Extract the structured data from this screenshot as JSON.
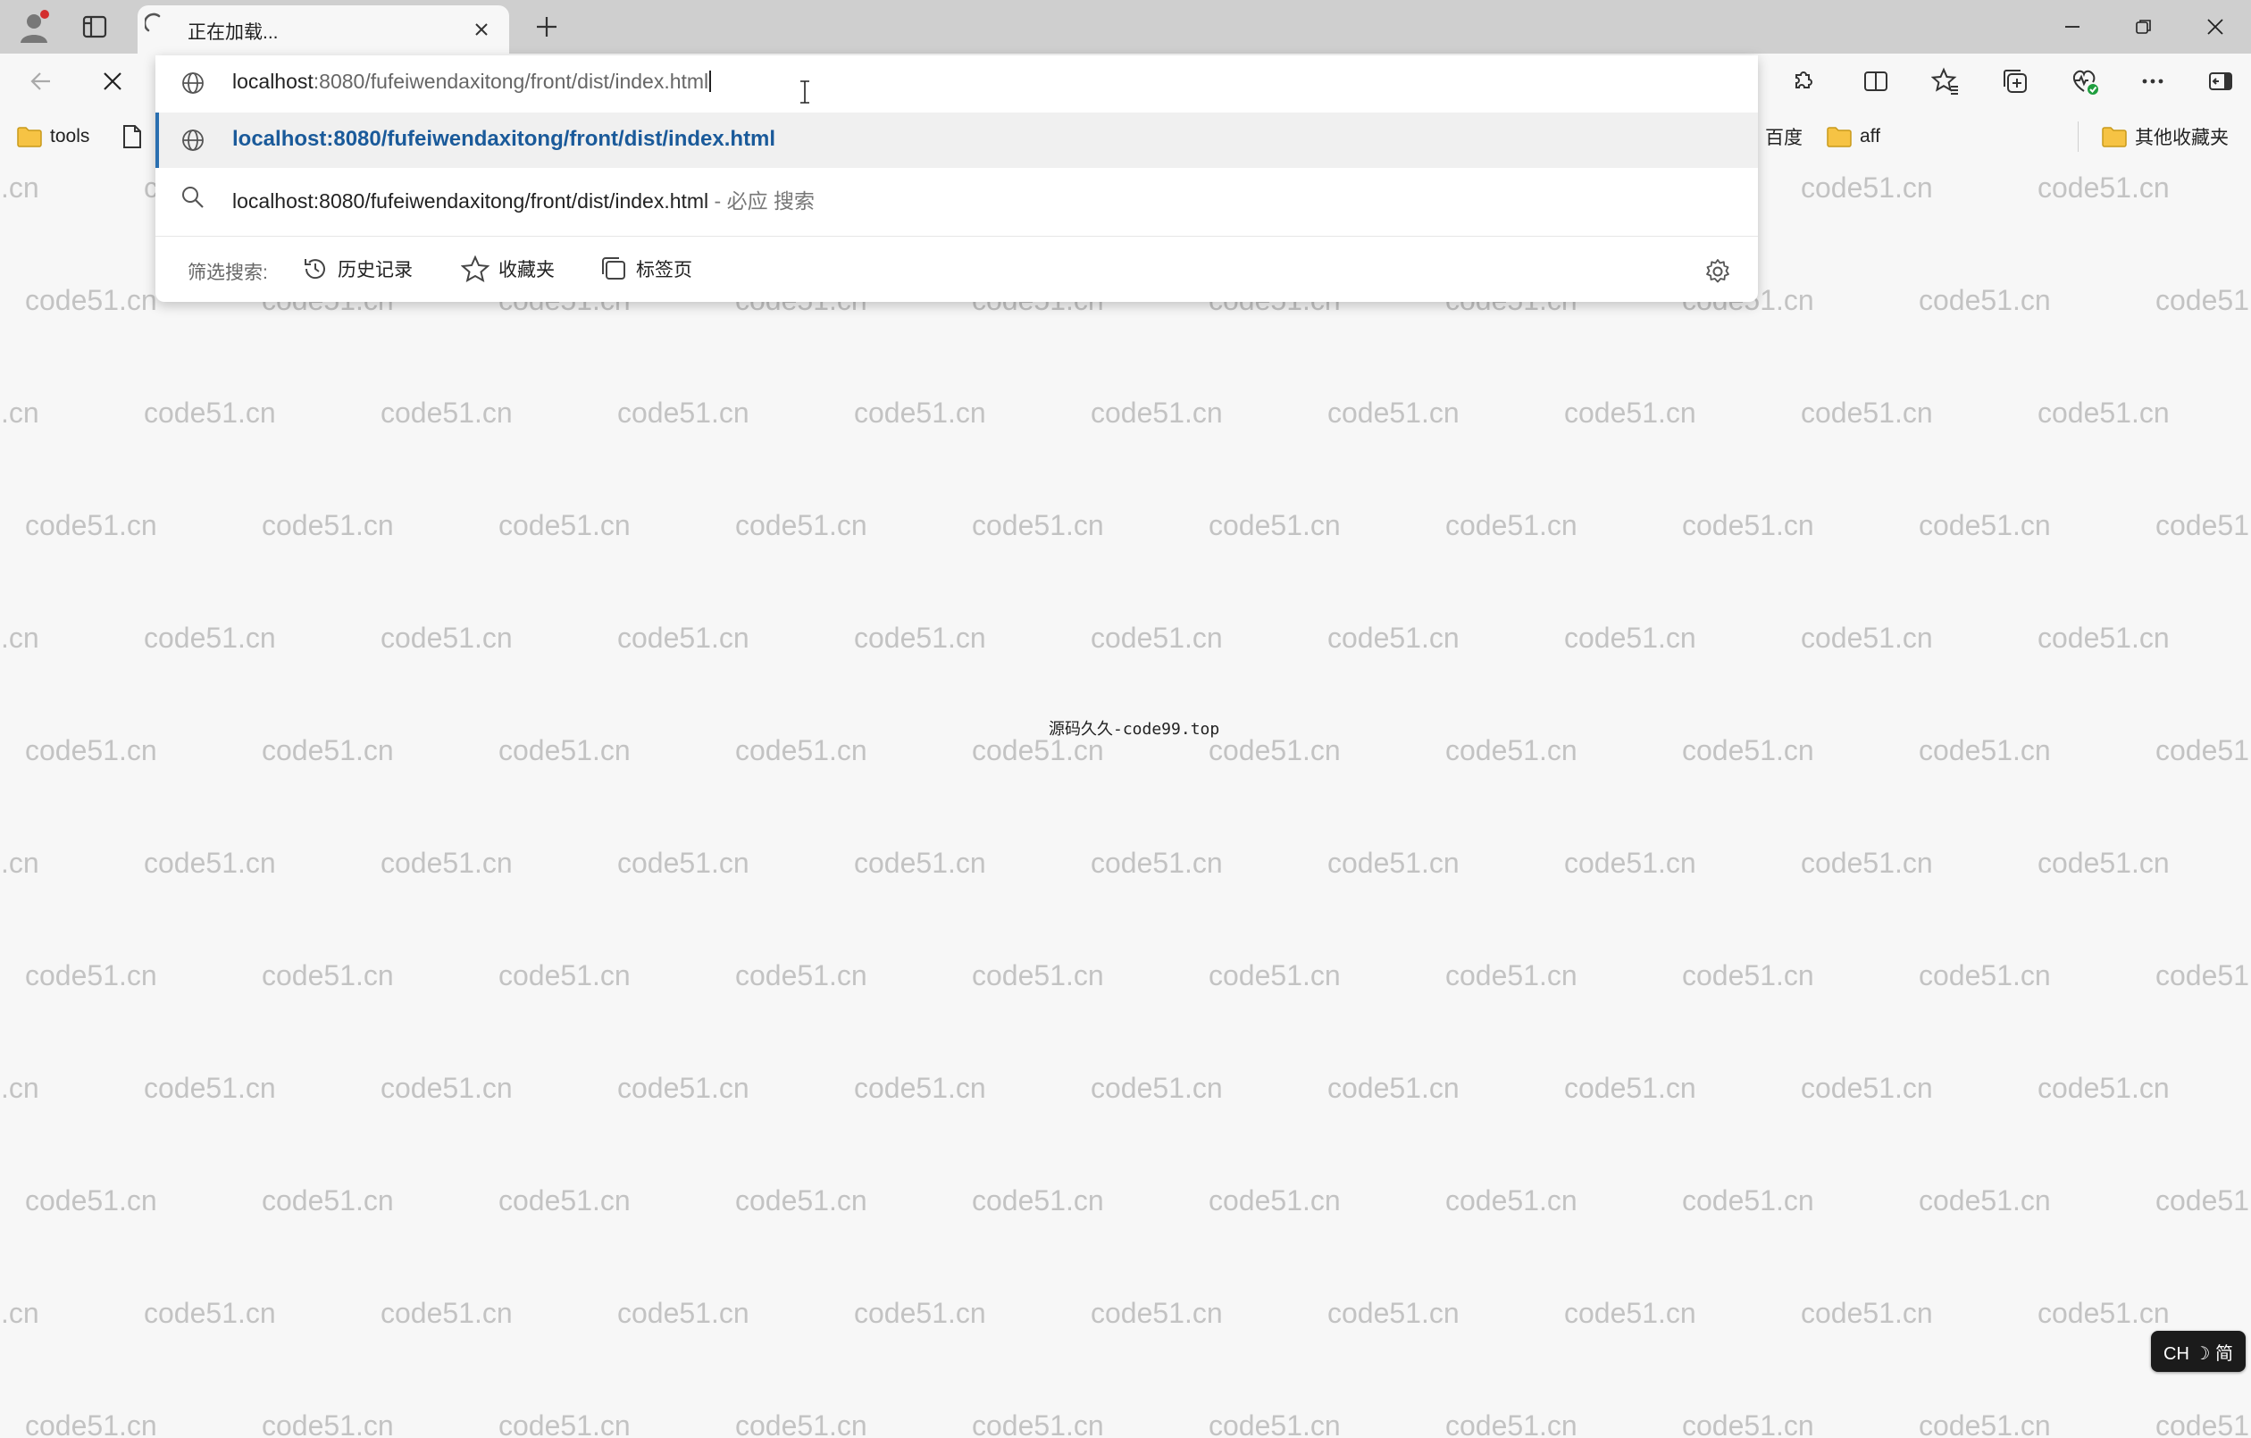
{
  "tab": {
    "title": "正在加载..."
  },
  "omnibox": {
    "value_host": "localhost",
    "value_path": ":8080/fufeiwendaxitong/front/dist/index.html",
    "suggestion_url": "localhost:8080/fufeiwendaxitong/front/dist/index.html",
    "search_text": "localhost:8080/fufeiwendaxitong/front/dist/index.html",
    "search_suffix": " - 必应 搜索",
    "filter_label": "筛选搜索:",
    "filters": [
      "历史记录",
      "收藏夹",
      "标签页"
    ]
  },
  "bookmarks": {
    "tools": "tools",
    "baidu": "百度",
    "aff": "aff",
    "other": "其他收藏夹"
  },
  "page": {
    "watermark": "code51.cn",
    "center_text": "源码久久-code99.top"
  },
  "ime": {
    "label": "CH ☽ 简"
  },
  "colors": {
    "accent": "#2a6fb0",
    "link": "#1a5a9a",
    "background": "#f7f7f7"
  }
}
